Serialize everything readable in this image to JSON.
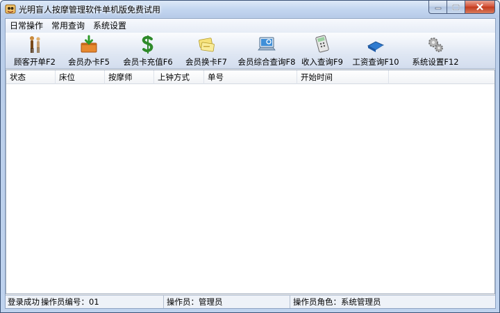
{
  "window": {
    "title": "光明盲人按摩管理软件单机版免费试用",
    "controls": [
      "minimize",
      "maximize",
      "close"
    ]
  },
  "menu": {
    "items": [
      "日常操作",
      "常用查询",
      "系统设置"
    ]
  },
  "toolbar": {
    "buttons": [
      {
        "label": "顾客开单F2",
        "icon": "customer-order-icon"
      },
      {
        "label": "会员办卡F5",
        "icon": "member-card-icon"
      },
      {
        "label": "会员卡充值F6",
        "icon": "recharge-dollar-icon"
      },
      {
        "label": "会员换卡F7",
        "icon": "card-exchange-icon"
      },
      {
        "label": "会员综合查询F8",
        "icon": "member-query-icon"
      },
      {
        "label": "收入查询F9",
        "icon": "income-calculator-icon"
      },
      {
        "label": "工资查询F10",
        "icon": "salary-book-icon"
      },
      {
        "label": "系统设置F12",
        "icon": "settings-gears-icon"
      }
    ]
  },
  "table": {
    "columns": [
      "状态",
      "床位",
      "按摩师",
      "上钟方式",
      "单号",
      "开始时间",
      ""
    ],
    "rows": []
  },
  "statusbar": {
    "login": "登录成功",
    "operator_id": "操作员编号：01",
    "operator": "操作员：管理员",
    "role": "操作员角色：系统管理员"
  },
  "colors": {
    "title_bar": "#c4d7f0",
    "close_button": "#c23a1d",
    "toolbar_bg": "#dfe7f3",
    "table_bg": "#ffffff"
  }
}
